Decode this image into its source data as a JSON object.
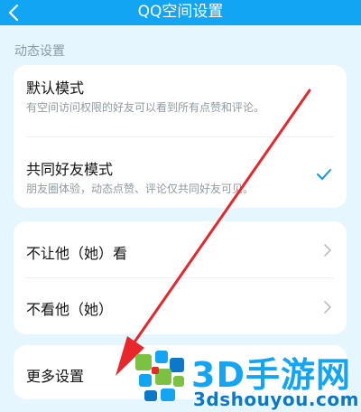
{
  "header": {
    "title": "QQ空间设置"
  },
  "section": {
    "label": "动态设置"
  },
  "mode_card": {
    "default_mode": {
      "title": "默认模式",
      "desc": "有空间访问权限的好友可以看到所有点赞和评论。"
    },
    "mutual_mode": {
      "title": "共同好友模式",
      "desc": "朋友圈体验，动态点赞、评论仅共同好友可见。",
      "selected": true
    }
  },
  "privacy_card": {
    "hide_from": {
      "label": "不让他（她）看"
    },
    "dont_view": {
      "label": "不看他（她）"
    }
  },
  "more_card": {
    "more_settings": {
      "label": "更多设置"
    }
  },
  "watermark": {
    "brand": "3D手游网",
    "url": "3dshouyou.com"
  },
  "colors": {
    "header": "#12a5f3",
    "check": "#1296db",
    "annotation_arrow": "#e8262b"
  }
}
